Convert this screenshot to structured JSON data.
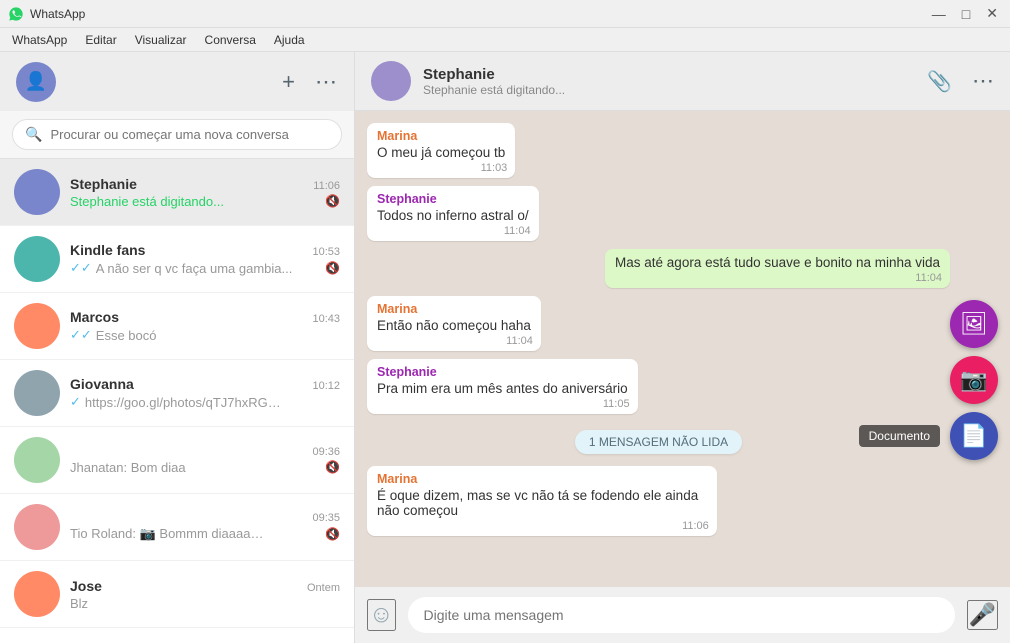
{
  "titleBar": {
    "title": "WhatsApp",
    "minBtn": "—",
    "maxBtn": "□",
    "closeBtn": "✕"
  },
  "menuBar": {
    "items": [
      "WhatsApp",
      "Editar",
      "Visualizar",
      "Conversa",
      "Ajuda"
    ]
  },
  "sidebar": {
    "searchPlaceholder": "Procurar ou começar uma nova conversa",
    "chats": [
      {
        "id": "stephanie",
        "name": "Stephanie está digitando...",
        "nameShort": "Stephanie",
        "preview": "Stephanie está digitando...",
        "time": "11:06",
        "isTyping": true,
        "muted": true,
        "active": true,
        "avatarClass": "c1"
      },
      {
        "id": "kindle",
        "name": "Kindle fans",
        "preview": "✓✓ A não ser q vc faça uma gambia...",
        "time": "10:53",
        "isTyping": false,
        "muted": true,
        "active": false,
        "avatarClass": "c2"
      },
      {
        "id": "marcos",
        "name": "Marcos",
        "preview": "✓✓ Esse bocó",
        "time": "10:43",
        "isTyping": false,
        "muted": false,
        "active": false,
        "avatarClass": "c3"
      },
      {
        "id": "giovanna",
        "name": "Giovanna",
        "preview": "✓ https://goo.gl/photos/qTJ7hxRGuP...",
        "time": "10:12",
        "isTyping": false,
        "muted": false,
        "active": false,
        "avatarClass": "c4"
      },
      {
        "id": "jhanatan",
        "name": "Jhanatan: Bom diaa",
        "preview": "Jhanatan: Bom diaa",
        "time": "09:36",
        "isTyping": false,
        "muted": true,
        "active": false,
        "avatarClass": "c5"
      },
      {
        "id": "tioroland",
        "name": "Tio Roland: 📷 Bommm diaaaaaaa g...",
        "preview": "Tio Roland: 📷 Bommm diaaaaaaa g...",
        "time": "09:35",
        "isTyping": false,
        "muted": true,
        "active": false,
        "avatarClass": "c6"
      },
      {
        "id": "jose",
        "name": "Jose",
        "preview": "Blz",
        "time": "Ontem",
        "isTyping": false,
        "muted": false,
        "active": false,
        "avatarClass": "c3"
      }
    ]
  },
  "chatHeader": {
    "name": "Stephanie",
    "status": "Stephanie está digitando..."
  },
  "messages": [
    {
      "id": 1,
      "sender": "Marina",
      "senderClass": "sender-marina",
      "text": "O meu já começou tb",
      "time": "11:03",
      "type": "incoming"
    },
    {
      "id": 2,
      "sender": "Stephanie",
      "senderClass": "sender-stephanie",
      "text": "Todos no inferno astral o/",
      "time": "11:04",
      "type": "incoming"
    },
    {
      "id": 3,
      "sender": "",
      "senderClass": "",
      "text": "Mas até agora está tudo suave e bonito na minha vida",
      "time": "11:04",
      "type": "outgoing"
    },
    {
      "id": 4,
      "sender": "Marina",
      "senderClass": "sender-marina",
      "text": "Então não começou haha",
      "time": "11:04",
      "type": "incoming"
    },
    {
      "id": 5,
      "sender": "Stephanie",
      "senderClass": "sender-stephanie",
      "text": "Pra mim era um mês antes do aniversário",
      "time": "11:05",
      "type": "incoming"
    }
  ],
  "unreadBadge": "1 MENSAGEM NÃO LIDA",
  "newMessages": [
    {
      "id": 6,
      "sender": "Marina",
      "senderClass": "sender-marina",
      "text": "É oque dizem, mas se vc não tá se fodendo ele ainda não começou",
      "time": "11:06",
      "type": "incoming"
    }
  ],
  "fabButtons": [
    {
      "icon": "🖼",
      "color": "fab-purple",
      "label": "Fotos"
    },
    {
      "icon": "📷",
      "color": "fab-red",
      "label": "Câmera"
    },
    {
      "icon": "📄",
      "color": "fab-blue",
      "label": "Documento",
      "tooltip": "Documento"
    }
  ],
  "inputBar": {
    "placeholder": "Digite uma mensagem",
    "emoji": "☺",
    "mic": "🎤"
  },
  "paperclipIcon": "📎",
  "moreIcon": "⋯",
  "addIcon": "+",
  "searchIconSymbol": "🔍"
}
